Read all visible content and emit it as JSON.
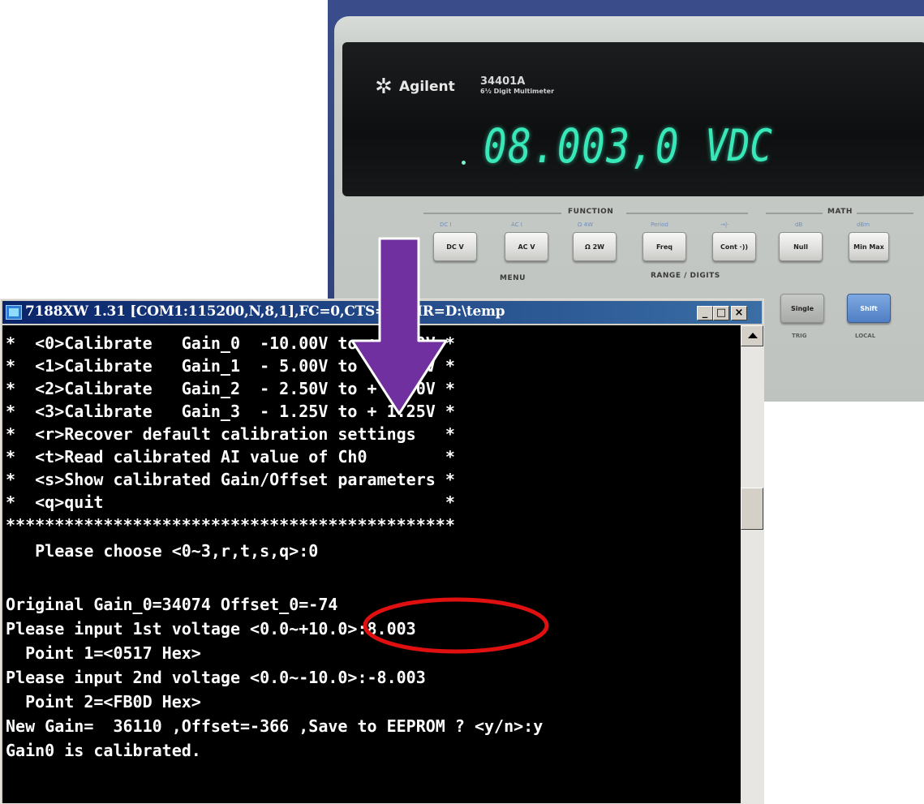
{
  "meter": {
    "brand": "Agilent",
    "brand_icon": "starburst-logo",
    "model": "34401A",
    "model_sub": "6½ Digit Multimeter",
    "reading": "08.003,0",
    "unit": "VDC",
    "display_color": "#38e8b8",
    "function_label": "FUNCTION",
    "math_label": "MATH",
    "menu_label": "MENU",
    "range_label": "RANGE / DIGITS",
    "soft_labels": [
      "DC I",
      "AC I",
      "Ω 4W",
      "Period",
      "→|-",
      "dB",
      "dBm"
    ],
    "buttons": [
      {
        "label": "DC V"
      },
      {
        "label": "AC V"
      },
      {
        "label": "Ω 2W"
      },
      {
        "label": "Freq"
      },
      {
        "label": "Cont ·))"
      },
      {
        "label": "Null"
      },
      {
        "label": "Min Max"
      }
    ],
    "bottom_buttons": [
      {
        "label": "Single"
      },
      {
        "label": "Shift"
      }
    ],
    "trig_label": "TRIG",
    "local_label": "LOCAL"
  },
  "window": {
    "title": "7188XW 1.31 [COM1:115200,N,8,1],FC=0,CTS=1, DIR=D:\\temp",
    "app_icon": "terminal-app-icon",
    "min_label": "_",
    "max_label": "□",
    "close_label": "×"
  },
  "terminal": {
    "lines": [
      "*  <0>Calibrate   Gain_0  -10.00V to +10.00V *",
      "*  <1>Calibrate   Gain_1  - 5.00V to + 5.00V *",
      "*  <2>Calibrate   Gain_2  - 2.50V to + 2.50V *",
      "*  <3>Calibrate   Gain_3  - 1.25V to + 1.25V *",
      "*  <r>Recover default calibration settings   *",
      "*  <t>Read calibrated AI value of Ch0        *",
      "*  <s>Show calibrated Gain/Offset parameters *",
      "*  <q>quit                                   *",
      "**********************************************",
      "   Please choose <0~3,r,t,s,q>:0",
      "",
      "Original Gain_0=34074 Offset_0=-74",
      "Please input 1st voltage <0.0~+10.0>:8.003",
      "  Point 1=<0517 Hex>",
      "Please input 2nd voltage <0.0~-10.0>:-8.003",
      "  Point 2=<FB0D Hex>",
      "New Gain=  36110 ,Offset=-366 ,Save to EEPROM ? <y/n>:y",
      "Gain0 is calibrated."
    ]
  },
  "overlay": {
    "arrow_color": "#7030a0",
    "ellipse_color": "#e01010"
  }
}
